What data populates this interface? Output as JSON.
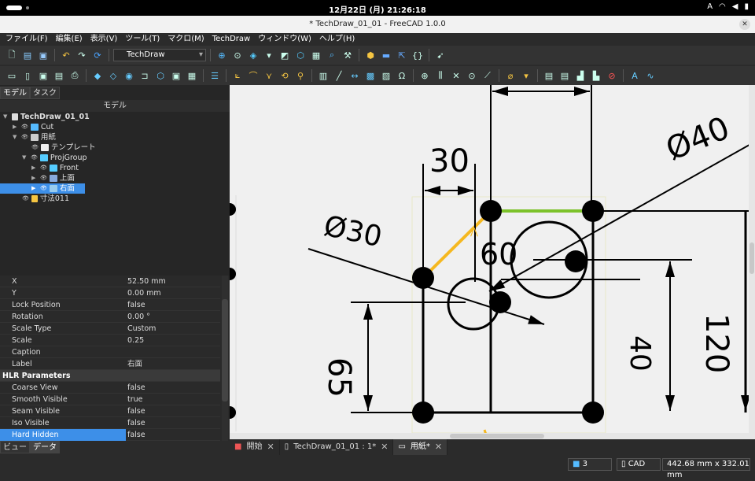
{
  "system": {
    "clock": "12月22日 (月)  21:26:18",
    "lang": "A"
  },
  "window": {
    "title": "* TechDraw_01_01 - FreeCAD 1.0.0"
  },
  "menu": [
    "ファイル(F)",
    "編集(E)",
    "表示(V)",
    "ツール(T)",
    "マクロ(M)",
    "TechDraw",
    "ウィンドウ(W)",
    "ヘルプ(H)"
  ],
  "toolbar": {
    "workbench": "TechDraw",
    "macro_label": "{}"
  },
  "panel": {
    "tabs": [
      "モデル",
      "タスク"
    ],
    "header": "モデル",
    "tree": [
      {
        "label": "TechDraw_01_01",
        "bold": true
      },
      {
        "label": "Cut"
      },
      {
        "label": "用紙"
      },
      {
        "label": "テンプレート"
      },
      {
        "label": "ProjGroup"
      },
      {
        "label": "Front"
      },
      {
        "label": "上面"
      },
      {
        "label": "右面"
      },
      {
        "label": "寸法011"
      }
    ],
    "properties": [
      {
        "k": "X",
        "v": "52.50 mm"
      },
      {
        "k": "Y",
        "v": "0.00 mm"
      },
      {
        "k": "Lock Position",
        "v": "false"
      },
      {
        "k": "Rotation",
        "v": "0.00 °"
      },
      {
        "k": "Scale Type",
        "v": "Custom"
      },
      {
        "k": "Scale",
        "v": "0.25"
      },
      {
        "k": "Caption",
        "v": ""
      },
      {
        "k": "Label",
        "v": "右面"
      },
      {
        "k": "HLR Parameters",
        "v": "",
        "group": true
      },
      {
        "k": "Coarse View",
        "v": "false"
      },
      {
        "k": "Smooth Visible",
        "v": "true"
      },
      {
        "k": "Seam Visible",
        "v": "false"
      },
      {
        "k": "Iso Visible",
        "v": "false"
      },
      {
        "k": "Hard Hidden",
        "v": "false"
      }
    ],
    "bottom_tabs": [
      "ビュー",
      "データ"
    ]
  },
  "drawing": {
    "dims": [
      "30",
      "Ø30",
      "60",
      "Ø40",
      "65",
      "40",
      "120"
    ]
  },
  "doc_tabs": [
    "開始",
    "TechDraw_01_01 : 1*",
    "用紙*"
  ],
  "status": {
    "page": "3",
    "nav": "CAD",
    "size": "442.68 mm x 332.01 mm"
  },
  "colors": {
    "accent": "#3d8fe8",
    "yellow": "#f5b820",
    "green": "#7cc22a"
  }
}
